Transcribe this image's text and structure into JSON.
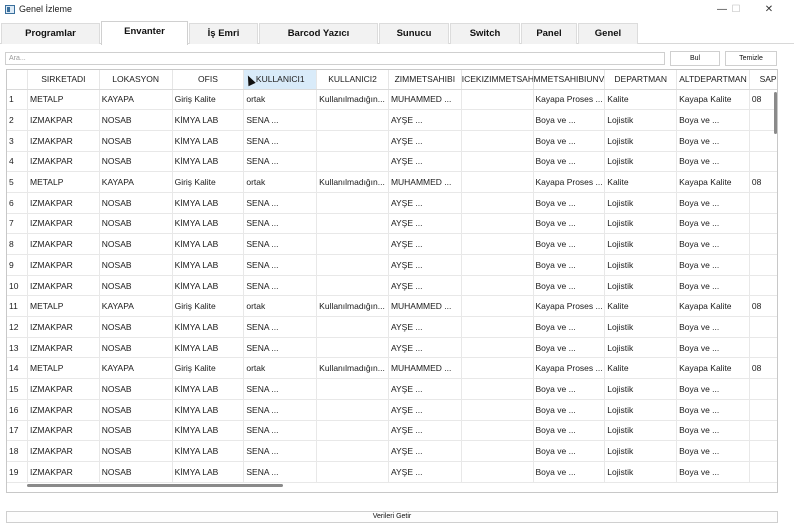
{
  "window": {
    "title": "Genel İzleme",
    "minimize_icon": "minimize-icon",
    "maximize_icon": "maximize-icon",
    "close_icon": "close-icon"
  },
  "tabs": [
    {
      "label": "Programlar",
      "active": false
    },
    {
      "label": "Envanter",
      "active": true
    },
    {
      "label": "İş Emri",
      "active": false
    },
    {
      "label": "Barcod Yazıcı",
      "active": false
    },
    {
      "label": "Sunucu",
      "active": false
    },
    {
      "label": "Switch",
      "active": false
    },
    {
      "label": "Panel",
      "active": false
    },
    {
      "label": "Genel",
      "active": false
    }
  ],
  "search": {
    "placeholder": "Ara...",
    "value": ""
  },
  "buttons": {
    "find": "Bul",
    "clear": "Temizle",
    "fetch": "Verileri Getir"
  },
  "grid": {
    "columns": [
      "",
      "SIRKETADI",
      "LOKASYON",
      "OFIS",
      "KULLANICI1",
      "KULLANICI2",
      "ZIMMETSAHIBI",
      "ICEKIZIMMETSAH",
      "MMETSAHIBIUNVA",
      "DEPARTMAN",
      "ALTDEPARTMAN",
      "SAPK"
    ],
    "highlighted_column": "KULLANICI1",
    "rows": [
      [
        "1",
        "METALP",
        "KAYAPA",
        "Giriş Kalite",
        "ortak",
        "Kullanılmadığın...",
        "MUHAMMED ...",
        "",
        "Kayapa Proses ...",
        "Kalite",
        "Kayapa Kalite",
        "08"
      ],
      [
        "2",
        "IZMAKPAR",
        "NOSAB",
        "KİMYA LAB",
        "SENA ...",
        "",
        "AYŞE ...",
        "",
        "Boya ve ...",
        "Lojistik",
        "Boya ve ...",
        ""
      ],
      [
        "3",
        "IZMAKPAR",
        "NOSAB",
        "KİMYA LAB",
        "SENA ...",
        "",
        "AYŞE ...",
        "",
        "Boya ve ...",
        "Lojistik",
        "Boya ve ...",
        ""
      ],
      [
        "4",
        "IZMAKPAR",
        "NOSAB",
        "KİMYA LAB",
        "SENA ...",
        "",
        "AYŞE ...",
        "",
        "Boya ve ...",
        "Lojistik",
        "Boya ve ...",
        ""
      ],
      [
        "5",
        "METALP",
        "KAYAPA",
        "Giriş Kalite",
        "ortak",
        "Kullanılmadığın...",
        "MUHAMMED ...",
        "",
        "Kayapa Proses ...",
        "Kalite",
        "Kayapa Kalite",
        "08"
      ],
      [
        "6",
        "IZMAKPAR",
        "NOSAB",
        "KİMYA LAB",
        "SENA ...",
        "",
        "AYŞE ...",
        "",
        "Boya ve ...",
        "Lojistik",
        "Boya ve ...",
        ""
      ],
      [
        "7",
        "IZMAKPAR",
        "NOSAB",
        "KİMYA LAB",
        "SENA ...",
        "",
        "AYŞE ...",
        "",
        "Boya ve ...",
        "Lojistik",
        "Boya ve ...",
        ""
      ],
      [
        "8",
        "IZMAKPAR",
        "NOSAB",
        "KİMYA LAB",
        "SENA ...",
        "",
        "AYŞE ...",
        "",
        "Boya ve ...",
        "Lojistik",
        "Boya ve ...",
        ""
      ],
      [
        "9",
        "IZMAKPAR",
        "NOSAB",
        "KİMYA LAB",
        "SENA ...",
        "",
        "AYŞE ...",
        "",
        "Boya ve ...",
        "Lojistik",
        "Boya ve ...",
        ""
      ],
      [
        "10",
        "IZMAKPAR",
        "NOSAB",
        "KİMYA LAB",
        "SENA ...",
        "",
        "AYŞE ...",
        "",
        "Boya ve ...",
        "Lojistik",
        "Boya ve ...",
        ""
      ],
      [
        "11",
        "METALP",
        "KAYAPA",
        "Giriş Kalite",
        "ortak",
        "Kullanılmadığın...",
        "MUHAMMED ...",
        "",
        "Kayapa Proses ...",
        "Kalite",
        "Kayapa Kalite",
        "08"
      ],
      [
        "12",
        "IZMAKPAR",
        "NOSAB",
        "KİMYA LAB",
        "SENA ...",
        "",
        "AYŞE ...",
        "",
        "Boya ve ...",
        "Lojistik",
        "Boya ve ...",
        ""
      ],
      [
        "13",
        "IZMAKPAR",
        "NOSAB",
        "KİMYA LAB",
        "SENA ...",
        "",
        "AYŞE ...",
        "",
        "Boya ve ...",
        "Lojistik",
        "Boya ve ...",
        ""
      ],
      [
        "14",
        "METALP",
        "KAYAPA",
        "Giriş Kalite",
        "ortak",
        "Kullanılmadığın...",
        "MUHAMMED ...",
        "",
        "Kayapa Proses ...",
        "Kalite",
        "Kayapa Kalite",
        "08"
      ],
      [
        "15",
        "IZMAKPAR",
        "NOSAB",
        "KİMYA LAB",
        "SENA ...",
        "",
        "AYŞE ...",
        "",
        "Boya ve ...",
        "Lojistik",
        "Boya ve ...",
        ""
      ],
      [
        "16",
        "IZMAKPAR",
        "NOSAB",
        "KİMYA LAB",
        "SENA ...",
        "",
        "AYŞE ...",
        "",
        "Boya ve ...",
        "Lojistik",
        "Boya ve ...",
        ""
      ],
      [
        "17",
        "IZMAKPAR",
        "NOSAB",
        "KİMYA LAB",
        "SENA ...",
        "",
        "AYŞE ...",
        "",
        "Boya ve ...",
        "Lojistik",
        "Boya ve ...",
        ""
      ],
      [
        "18",
        "IZMAKPAR",
        "NOSAB",
        "KİMYA LAB",
        "SENA ...",
        "",
        "AYŞE ...",
        "",
        "Boya ve ...",
        "Lojistik",
        "Boya ve ...",
        ""
      ],
      [
        "19",
        "IZMAKPAR",
        "NOSAB",
        "KİMYA LAB",
        "SENA ...",
        "",
        "AYŞE ...",
        "",
        "Boya ve ...",
        "Lojistik",
        "Boya ve ...",
        ""
      ]
    ]
  },
  "colors": {
    "header_highlight": "#d9ebf9",
    "active_tab": "#ffffff",
    "inactive_tab": "#f2f2f2"
  }
}
